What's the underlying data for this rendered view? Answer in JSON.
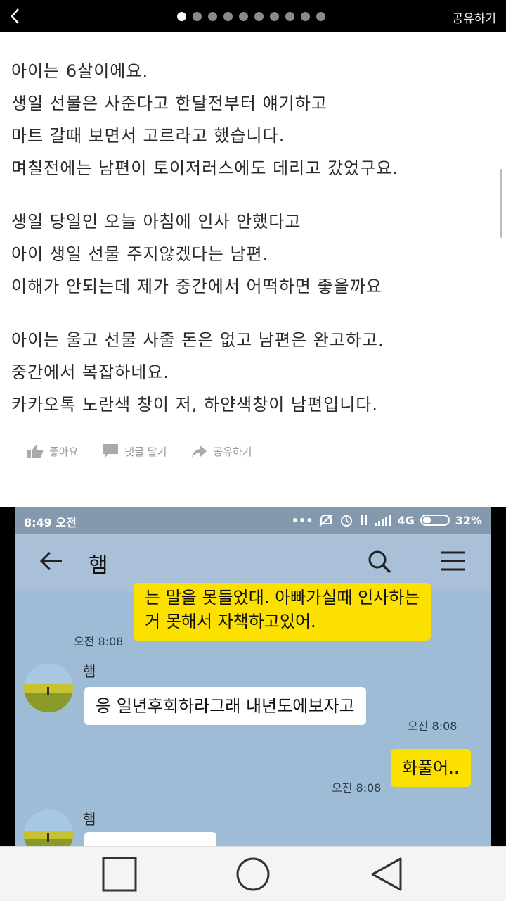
{
  "topbar": {
    "share_label": "공유하기",
    "page_count": 10,
    "active_page": 1
  },
  "article": {
    "paragraphs": [
      [
        "아이는 6살이에요.",
        "생일 선물은 사준다고 한달전부터 얘기하고",
        "마트 갈때 보면서 고르라고 했습니다.",
        "며칠전에는 남편이 토이저러스에도 데리고 갔었구요."
      ],
      [
        "생일 당일인 오늘 아침에 인사 안했다고",
        "아이 생일 선물 주지않겠다는 남편.",
        "이해가 안되는데 제가 중간에서 어떡하면 좋을까요"
      ],
      [
        "아이는 울고 선물 사줄 돈은 없고 남편은 완고하고.",
        "중간에서 복잡하네요.",
        "카카오톡 노란색 창이 저, 하얀색창이 남편입니다."
      ]
    ]
  },
  "actions": {
    "like": "좋아요",
    "comment": "댓글 달기",
    "share": "공유하기"
  },
  "chat": {
    "status": {
      "time": "8:49 오전",
      "network": "4G",
      "battery": "32%"
    },
    "title": "햄",
    "messages": [
      {
        "from": "me",
        "lines": [
          "는 말을 못들었대. 아빠가실때  인사하는",
          "거 못해서 자책하고있어."
        ],
        "time": "오전 8:08"
      },
      {
        "from": "other",
        "sender": "햄",
        "text": "응 일년후회하라그래 내년도에보자고",
        "time": "오전 8:08"
      },
      {
        "from": "me",
        "text": "화풀어..",
        "time": "오전 8:08"
      },
      {
        "from": "other",
        "sender": "햄"
      }
    ]
  },
  "colors": {
    "my_bubble": "#fbe000",
    "their_bubble": "#ffffff",
    "chat_bg": "#9fbcd6"
  }
}
